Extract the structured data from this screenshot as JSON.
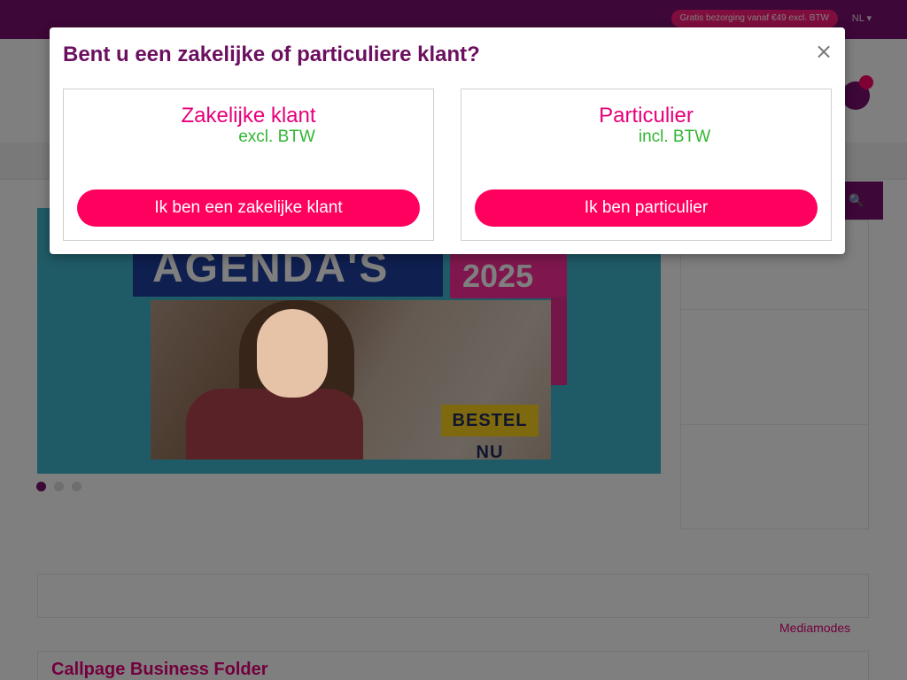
{
  "topbar": {
    "promo_pill": "Gratis bezorging vanaf €49 excl. BTW",
    "language": "NL ▾"
  },
  "search": {
    "label": "🔍"
  },
  "banner": {
    "title": "AGENDA'S",
    "year": "2025",
    "cta": "BESTEL NU",
    "slides": 3,
    "active_slide": 1
  },
  "listing": {
    "mediamodes_link": "Mediamodes",
    "product_title": "Callpage Business Folder"
  },
  "modal": {
    "title": "Bent u een zakelijke of particuliere klant?",
    "close_label": "×",
    "business": {
      "title": "Zakelijke klant",
      "subtitle": "excl. BTW",
      "button": "Ik ben een zakelijke klant"
    },
    "private": {
      "title": "Particulier",
      "subtitle": "incl. BTW",
      "button": "Ik ben particulier"
    }
  },
  "colors": {
    "brand_purple": "#7a0f6e",
    "accent_pink": "#ff005f",
    "title_pink": "#e6007a",
    "tax_green": "#33b533",
    "modal_title": "#6b0f5f"
  }
}
